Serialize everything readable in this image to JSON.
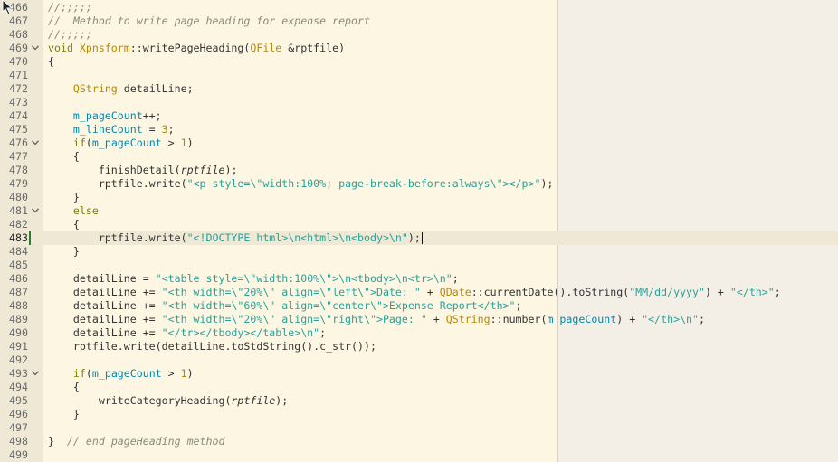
{
  "editor": {
    "current_line": 483,
    "lines": [
      {
        "n": "466",
        "fold": false,
        "tokens": [
          {
            "c": "cm",
            "t": "//;;;;;"
          }
        ]
      },
      {
        "n": "467",
        "fold": false,
        "tokens": [
          {
            "c": "cm",
            "t": "//  Method to write page heading for expense report"
          }
        ]
      },
      {
        "n": "468",
        "fold": false,
        "tokens": [
          {
            "c": "cm",
            "t": "//;;;;;"
          }
        ]
      },
      {
        "n": "469",
        "fold": true,
        "tokens": [
          {
            "c": "kw",
            "t": "void"
          },
          {
            "c": "",
            "t": " "
          },
          {
            "c": "ty",
            "t": "Xpnsform"
          },
          {
            "c": "",
            "t": "::writePageHeading("
          },
          {
            "c": "ty",
            "t": "QFile"
          },
          {
            "c": "",
            "t": " &rptfile)"
          }
        ]
      },
      {
        "n": "470",
        "fold": false,
        "tokens": [
          {
            "c": "",
            "t": "{"
          }
        ]
      },
      {
        "n": "471",
        "fold": false,
        "tokens": []
      },
      {
        "n": "472",
        "fold": false,
        "tokens": [
          {
            "c": "",
            "t": "    "
          },
          {
            "c": "ty",
            "t": "QString"
          },
          {
            "c": "",
            "t": " detailLine;"
          }
        ]
      },
      {
        "n": "473",
        "fold": false,
        "tokens": []
      },
      {
        "n": "474",
        "fold": false,
        "tokens": [
          {
            "c": "",
            "t": "    "
          },
          {
            "c": "nm",
            "t": "m_pageCount"
          },
          {
            "c": "",
            "t": "++;"
          }
        ]
      },
      {
        "n": "475",
        "fold": false,
        "tokens": [
          {
            "c": "",
            "t": "    "
          },
          {
            "c": "nm",
            "t": "m_lineCount"
          },
          {
            "c": "",
            "t": " = "
          },
          {
            "c": "ty",
            "t": "3"
          },
          {
            "c": "",
            "t": ";"
          }
        ]
      },
      {
        "n": "476",
        "fold": true,
        "tokens": [
          {
            "c": "",
            "t": "    "
          },
          {
            "c": "kw",
            "t": "if"
          },
          {
            "c": "",
            "t": "("
          },
          {
            "c": "nm",
            "t": "m_pageCount"
          },
          {
            "c": "",
            "t": " > "
          },
          {
            "c": "ty",
            "t": "1"
          },
          {
            "c": "",
            "t": ")"
          }
        ]
      },
      {
        "n": "477",
        "fold": false,
        "tokens": [
          {
            "c": "",
            "t": "    {"
          }
        ]
      },
      {
        "n": "478",
        "fold": false,
        "tokens": [
          {
            "c": "",
            "t": "        finishDetail("
          },
          {
            "c": "it",
            "t": "rptfile"
          },
          {
            "c": "",
            "t": ");"
          }
        ]
      },
      {
        "n": "479",
        "fold": false,
        "tokens": [
          {
            "c": "",
            "t": "        rptfile.write("
          },
          {
            "c": "st",
            "t": "\"<p style=\\\"width:100%; page-break-before:always\\\"></p>\""
          },
          {
            "c": "",
            "t": ");"
          }
        ]
      },
      {
        "n": "480",
        "fold": false,
        "tokens": [
          {
            "c": "",
            "t": "    }"
          }
        ]
      },
      {
        "n": "481",
        "fold": true,
        "tokens": [
          {
            "c": "",
            "t": "    "
          },
          {
            "c": "kw",
            "t": "else"
          }
        ]
      },
      {
        "n": "482",
        "fold": false,
        "tokens": [
          {
            "c": "",
            "t": "    {"
          }
        ]
      },
      {
        "n": "483",
        "fold": false,
        "tokens": [
          {
            "c": "",
            "t": "        rptfile.write("
          },
          {
            "c": "st",
            "t": "\"<!DOCTYPE html>\\n<html>\\n<body>\\n\""
          },
          {
            "c": "",
            "t": ");"
          }
        ]
      },
      {
        "n": "484",
        "fold": false,
        "tokens": [
          {
            "c": "",
            "t": "    }"
          }
        ]
      },
      {
        "n": "485",
        "fold": false,
        "tokens": []
      },
      {
        "n": "486",
        "fold": false,
        "tokens": [
          {
            "c": "",
            "t": "    detailLine = "
          },
          {
            "c": "st",
            "t": "\"<table style=\\\"width:100%\\\">\\n<tbody>\\n<tr>\\n\""
          },
          {
            "c": "",
            "t": ";"
          }
        ]
      },
      {
        "n": "487",
        "fold": false,
        "tokens": [
          {
            "c": "",
            "t": "    detailLine += "
          },
          {
            "c": "st",
            "t": "\"<th width=\\\"20%\\\" align=\\\"left\\\">Date: \""
          },
          {
            "c": "",
            "t": " + "
          },
          {
            "c": "ty",
            "t": "QDate"
          },
          {
            "c": "",
            "t": "::currentDate().toString("
          },
          {
            "c": "st",
            "t": "\"MM/dd/yyyy\""
          },
          {
            "c": "",
            "t": ") + "
          },
          {
            "c": "st",
            "t": "\"</th>\""
          },
          {
            "c": "",
            "t": ";"
          }
        ]
      },
      {
        "n": "488",
        "fold": false,
        "tokens": [
          {
            "c": "",
            "t": "    detailLine += "
          },
          {
            "c": "st",
            "t": "\"<th width=\\\"60%\\\" align=\\\"center\\\">Expense Report</th>\""
          },
          {
            "c": "",
            "t": ";"
          }
        ]
      },
      {
        "n": "489",
        "fold": false,
        "tokens": [
          {
            "c": "",
            "t": "    detailLine += "
          },
          {
            "c": "st",
            "t": "\"<th width=\\\"20%\\\" align=\\\"right\\\">Page: \""
          },
          {
            "c": "",
            "t": " + "
          },
          {
            "c": "ty",
            "t": "QString"
          },
          {
            "c": "",
            "t": "::number("
          },
          {
            "c": "nm",
            "t": "m_pageCount"
          },
          {
            "c": "",
            "t": ") + "
          },
          {
            "c": "st",
            "t": "\"</th>\\n\""
          },
          {
            "c": "",
            "t": ";"
          }
        ]
      },
      {
        "n": "490",
        "fold": false,
        "tokens": [
          {
            "c": "",
            "t": "    detailLine += "
          },
          {
            "c": "st",
            "t": "\"</tr></tbody></table>\\n\""
          },
          {
            "c": "",
            "t": ";"
          }
        ]
      },
      {
        "n": "491",
        "fold": false,
        "tokens": [
          {
            "c": "",
            "t": "    rptfile.write(detailLine.toStdString().c_str());"
          }
        ]
      },
      {
        "n": "492",
        "fold": false,
        "tokens": []
      },
      {
        "n": "493",
        "fold": true,
        "tokens": [
          {
            "c": "",
            "t": "    "
          },
          {
            "c": "kw",
            "t": "if"
          },
          {
            "c": "",
            "t": "("
          },
          {
            "c": "nm",
            "t": "m_pageCount"
          },
          {
            "c": "",
            "t": " > "
          },
          {
            "c": "ty",
            "t": "1"
          },
          {
            "c": "",
            "t": ")"
          }
        ]
      },
      {
        "n": "494",
        "fold": false,
        "tokens": [
          {
            "c": "",
            "t": "    {"
          }
        ]
      },
      {
        "n": "495",
        "fold": false,
        "tokens": [
          {
            "c": "",
            "t": "        writeCategoryHeading("
          },
          {
            "c": "it",
            "t": "rptfile"
          },
          {
            "c": "",
            "t": ");"
          }
        ]
      },
      {
        "n": "496",
        "fold": false,
        "tokens": [
          {
            "c": "",
            "t": "    }"
          }
        ]
      },
      {
        "n": "497",
        "fold": false,
        "tokens": []
      },
      {
        "n": "498",
        "fold": false,
        "tokens": [
          {
            "c": "",
            "t": "}  "
          },
          {
            "c": "cm",
            "t": "// end pageHeading method"
          }
        ]
      },
      {
        "n": "499",
        "fold": false,
        "tokens": []
      }
    ]
  }
}
